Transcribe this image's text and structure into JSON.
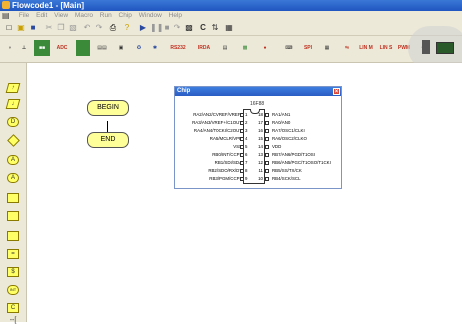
{
  "window": {
    "title": "Flowcode1 - [Main]"
  },
  "menu": {
    "items": [
      "File",
      "Edit",
      "View",
      "Macro",
      "Run",
      "Chip",
      "Window",
      "Help"
    ]
  },
  "toolbar_components": {
    "labels": [
      "ADC",
      "RS232",
      "IRDA",
      "SPI",
      "LIN M",
      "LIN S",
      "PWM"
    ]
  },
  "flowchart": {
    "begin": "BEGIN",
    "end": "END"
  },
  "chip": {
    "title": "Chip",
    "part": "16F88",
    "left_pins": [
      {
        "num": "1",
        "name": "RA2/AN2/CVREF/VREF-"
      },
      {
        "num": "2",
        "name": "RA3/AN3/VREF+/C1OUT"
      },
      {
        "num": "3",
        "name": "RA4/AN4/T0CKI/C2OUT"
      },
      {
        "num": "4",
        "name": "RA5/MCLR/VPP"
      },
      {
        "num": "5",
        "name": "VSS"
      },
      {
        "num": "6",
        "name": "RB0/INT/CCP1"
      },
      {
        "num": "7",
        "name": "RB1/SDI/SDA"
      },
      {
        "num": "8",
        "name": "RB2/SDO/RX/DT"
      },
      {
        "num": "9",
        "name": "RB3/PGM/CCP1"
      }
    ],
    "right_pins": [
      {
        "num": "18",
        "name": "RA1/AN1"
      },
      {
        "num": "17",
        "name": "RA0/AN0"
      },
      {
        "num": "16",
        "name": "RA7/OSC1/CLKI"
      },
      {
        "num": "15",
        "name": "RA6/OSC2/CLKO"
      },
      {
        "num": "14",
        "name": "VDD"
      },
      {
        "num": "13",
        "name": "RB7/AN6/PGD/T1OSI"
      },
      {
        "num": "12",
        "name": "RB6/AN5/PGC/T1OSO/T1CKI"
      },
      {
        "num": "11",
        "name": "RB5/SS/TX/CK"
      },
      {
        "num": "10",
        "name": "RB4/SCK/SCL"
      }
    ]
  }
}
